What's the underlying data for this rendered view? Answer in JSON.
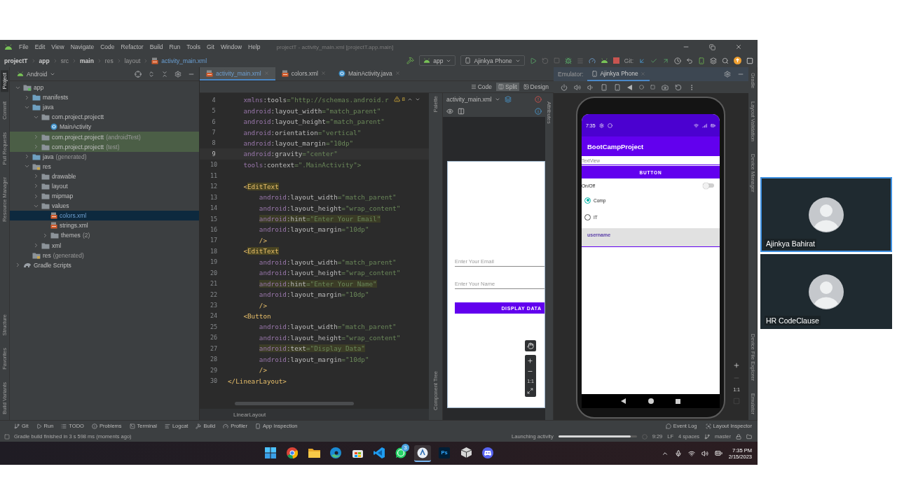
{
  "window": {
    "title": "projectT - activity_main.xml [projectT.app.main]",
    "menu": [
      "File",
      "Edit",
      "View",
      "Navigate",
      "Code",
      "Refactor",
      "Build",
      "Run",
      "Tools",
      "Git",
      "Window",
      "Help"
    ]
  },
  "breadcrumbs": [
    {
      "label": "projectT",
      "kind": "bold"
    },
    {
      "label": "app",
      "kind": "bold"
    },
    {
      "label": "src",
      "kind": "plain"
    },
    {
      "label": "main",
      "kind": "bold"
    },
    {
      "label": "res",
      "kind": "plain"
    },
    {
      "label": "layout",
      "kind": "plain"
    },
    {
      "label": "activity_main.xml",
      "kind": "file"
    }
  ],
  "toolbar": {
    "run_config": "app",
    "device": "Ajinkya Phone",
    "git_label": "Git:"
  },
  "left_strip": {
    "top": [
      {
        "label": "Project",
        "selected": true
      },
      {
        "label": "Commit",
        "selected": false
      },
      {
        "label": "Pull Requests",
        "selected": false
      },
      {
        "label": "Resource Manager",
        "selected": false
      }
    ],
    "bottom": [
      {
        "label": "Structure",
        "selected": false
      },
      {
        "label": "Favorites",
        "selected": false
      },
      {
        "label": "Build Variants",
        "selected": false
      }
    ]
  },
  "project": {
    "view": "Android",
    "tree": [
      {
        "label": "app",
        "kind": "module",
        "expanded": true,
        "selected": false,
        "highlighted": false,
        "children": [
          {
            "label": "manifests",
            "kind": "folder",
            "expanded": false,
            "selected": false,
            "highlighted": false
          },
          {
            "label": "java",
            "kind": "folder",
            "expanded": true,
            "selected": false,
            "highlighted": false,
            "children": [
              {
                "label": "com.project.projectt",
                "kind": "package",
                "expanded": true,
                "selected": false,
                "highlighted": false,
                "children": [
                  {
                    "label": "MainActivity",
                    "kind": "class",
                    "selected": false,
                    "highlighted": false
                  }
                ]
              },
              {
                "label": "com.project.projectt",
                "note": "(androidTest)",
                "kind": "package",
                "expanded": false,
                "selected": false,
                "highlighted": true
              },
              {
                "label": "com.project.projectt",
                "note": "(test)",
                "kind": "package",
                "expanded": false,
                "selected": false,
                "highlighted": true
              }
            ]
          },
          {
            "label": "java",
            "note": "(generated)",
            "kind": "folder",
            "expanded": false,
            "selected": false,
            "highlighted": false
          },
          {
            "label": "res",
            "kind": "resfolder",
            "expanded": true,
            "selected": false,
            "highlighted": false,
            "children": [
              {
                "label": "drawable",
                "kind": "package",
                "expanded": false,
                "selected": false,
                "highlighted": false
              },
              {
                "label": "layout",
                "kind": "package",
                "expanded": false,
                "selected": false,
                "highlighted": false
              },
              {
                "label": "mipmap",
                "kind": "package",
                "expanded": false,
                "selected": false,
                "highlighted": false
              },
              {
                "label": "values",
                "kind": "package",
                "expanded": true,
                "selected": false,
                "highlighted": false,
                "children": [
                  {
                    "label": "colors.xml",
                    "kind": "xml",
                    "selected": true,
                    "highlighted": false
                  },
                  {
                    "label": "strings.xml",
                    "kind": "xml",
                    "selected": false,
                    "highlighted": false
                  },
                  {
                    "label": "themes",
                    "note": "(2)",
                    "kind": "package",
                    "expanded": false,
                    "selected": false,
                    "highlighted": false
                  }
                ]
              },
              {
                "label": "xml",
                "kind": "package",
                "expanded": false,
                "selected": false,
                "highlighted": false
              }
            ]
          },
          {
            "label": "res",
            "note": "(generated)",
            "kind": "resfolder",
            "selected": false,
            "highlighted": false
          }
        ]
      },
      {
        "label": "Gradle Scripts",
        "kind": "gradle",
        "expanded": false,
        "selected": false,
        "highlighted": false
      }
    ]
  },
  "editor_tabs": [
    {
      "label": "activity_main.xml",
      "kind": "xml",
      "selected": true
    },
    {
      "label": "colors.xml",
      "kind": "xml",
      "selected": false
    },
    {
      "label": "MainActivity.java",
      "kind": "class",
      "selected": false
    }
  ],
  "view_modes": [
    {
      "label": "Code",
      "selected": false
    },
    {
      "label": "Split",
      "selected": true
    },
    {
      "label": "Design",
      "selected": false
    }
  ],
  "code": {
    "warning_count": "8",
    "breadcrumb": "LinearLayout",
    "lines": [
      {
        "number": "4",
        "kind": "plain",
        "text": "    xmlns:tools=\"http://schemas.android.r"
      },
      {
        "number": "5",
        "kind": "plain",
        "text": "    android:layout_width=\"match_parent\""
      },
      {
        "number": "6",
        "kind": "plain",
        "text": "    android:layout_height=\"match_parent\""
      },
      {
        "number": "7",
        "kind": "plain",
        "text": "    android:orientation=\"vertical\""
      },
      {
        "number": "8",
        "kind": "plain",
        "text": "    android:layout_margin=\"10dp\""
      },
      {
        "number": "9",
        "kind": "current",
        "text": "    android:gravity=\"center\""
      },
      {
        "number": "10",
        "kind": "plain",
        "text": "    tools:context=\".MainActivity\">"
      },
      {
        "number": "11",
        "kind": "plain"
      },
      {
        "number": "12",
        "kind": "matched",
        "text": "    <EditText"
      },
      {
        "number": "13",
        "kind": "plain",
        "text": "        android:layout_width=\"match_parent\""
      },
      {
        "number": "14",
        "kind": "plain",
        "text": "        android:layout_height=\"wrap_content\""
      },
      {
        "number": "15",
        "kind": "highlight",
        "text": "        android:hint=\"Enter Your Email\""
      },
      {
        "number": "16",
        "kind": "plain",
        "text": "        android:layout_margin=\"10dp\""
      },
      {
        "number": "17",
        "kind": "plain",
        "text": "        />"
      },
      {
        "number": "18",
        "kind": "matched",
        "text": "    <EditText"
      },
      {
        "number": "19",
        "kind": "plain",
        "text": "        android:layout_width=\"match_parent\""
      },
      {
        "number": "20",
        "kind": "plain",
        "text": "        android:layout_height=\"wrap_content\""
      },
      {
        "number": "21",
        "kind": "highlight",
        "text": "        android:hint=\"Enter Your Name\""
      },
      {
        "number": "22",
        "kind": "plain",
        "text": "        android:layout_margin=\"10dp\""
      },
      {
        "number": "23",
        "kind": "plain",
        "text": "        />"
      },
      {
        "number": "24",
        "kind": "plain",
        "text": "    <Button"
      },
      {
        "number": "25",
        "kind": "plain",
        "text": "        android:layout_width=\"match_parent\""
      },
      {
        "number": "26",
        "kind": "plain",
        "text": "        android:layout_height=\"wrap_content\""
      },
      {
        "number": "27",
        "kind": "highlight",
        "text": "        android:text=\"Display Data\""
      },
      {
        "number": "28",
        "kind": "plain",
        "text": "        android:layout_margin=\"10dp\""
      },
      {
        "number": "29",
        "kind": "plain",
        "text": "        />"
      },
      {
        "number": "30",
        "kind": "plain",
        "text": "</LinearLayout>"
      }
    ]
  },
  "design": {
    "file": "activity_main.xml",
    "palette_label": "Palette",
    "component_tree_label": "Component Tree",
    "attributes_label": "Attributes",
    "fields": [
      {
        "placeholder": "Enter Your Email"
      },
      {
        "placeholder": "Enter Your Name"
      }
    ],
    "button": "DISPLAY DATA",
    "zoom_fit": "1:1"
  },
  "emulator": {
    "label": "Emulator:",
    "tab": "Ajinkya Phone",
    "zoom_fit": "1:1",
    "phone": {
      "time": "7:35",
      "app_title": "BootCampProject",
      "text_view": "TextView",
      "button": "BUTTON",
      "switch": {
        "label": "On/Off",
        "on": false
      },
      "radios": [
        {
          "label": "Comp",
          "selected": true
        },
        {
          "label": "IT",
          "selected": false
        }
      ],
      "username": {
        "placeholder": "username"
      }
    }
  },
  "right_strip": {
    "top": [
      "Gradle",
      "Layout Validation",
      "Device Manager"
    ],
    "bottom": [
      "Device File Explorer",
      "Emulator"
    ]
  },
  "tool_windows": {
    "left": [
      {
        "label": "Git",
        "kind": "git"
      },
      {
        "label": "Run",
        "kind": "run"
      },
      {
        "label": "TODO",
        "kind": "todo"
      },
      {
        "label": "Problems",
        "kind": "problems"
      },
      {
        "label": "Terminal",
        "kind": "terminal"
      },
      {
        "label": "Logcat",
        "kind": "logcat"
      },
      {
        "label": "Build",
        "kind": "build"
      },
      {
        "label": "Profiler",
        "kind": "profiler"
      },
      {
        "label": "App Inspection",
        "kind": "inspection"
      }
    ],
    "right": [
      {
        "label": "Event Log",
        "kind": "event-log"
      },
      {
        "label": "Layout Inspector",
        "kind": "layout-inspector"
      }
    ]
  },
  "status_bar": {
    "message": "Gradle build finished in 3 s 598 ms (moments ago)",
    "task": "Launching activity",
    "progress": {
      "level": 0.92
    },
    "position": "9:29",
    "line_separator": "LF",
    "indent": "4 spaces",
    "branch": "master"
  },
  "taskbar": {
    "apps": [
      {
        "kind": "start",
        "active": false
      },
      {
        "kind": "chrome",
        "active": false
      },
      {
        "kind": "files",
        "active": false
      },
      {
        "kind": "edge",
        "active": false
      },
      {
        "kind": "store",
        "active": false
      },
      {
        "kind": "vscode",
        "active": false
      },
      {
        "kind": "whatsapp",
        "active": false,
        "badge": "3"
      },
      {
        "kind": "studio",
        "active": true
      },
      {
        "kind": "photoshop",
        "active": false,
        "label": "Ps"
      },
      {
        "kind": "cube",
        "active": false
      },
      {
        "kind": "discord",
        "active": false
      }
    ],
    "time": "7:35 PM",
    "date": "2/15/2023"
  },
  "participants": [
    {
      "name": "Ajinkya Bahirat",
      "selected": true
    },
    {
      "name": "HR CodeClause",
      "selected": false
    }
  ]
}
